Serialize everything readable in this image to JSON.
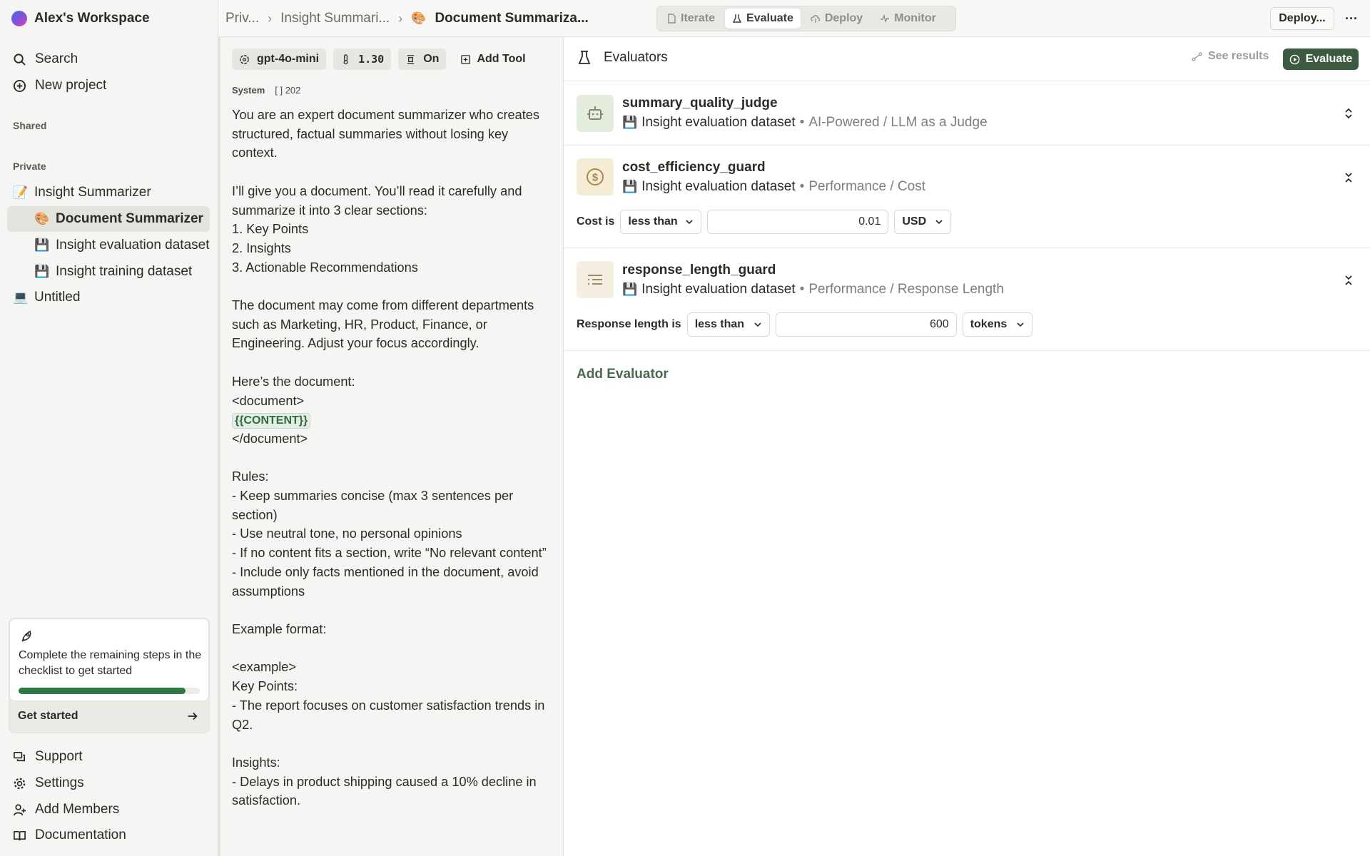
{
  "workspace": {
    "name": "Alex's Workspace"
  },
  "sidebar": {
    "search": "Search",
    "new_project": "New project",
    "shared_label": "Shared",
    "private_label": "Private",
    "tree": [
      {
        "emoji": "📝",
        "label": "Insight Summarizer"
      },
      {
        "emoji": "🎨",
        "label": "Document Summarizer"
      },
      {
        "emoji": "💾",
        "label": "Insight evaluation dataset"
      },
      {
        "emoji": "💾",
        "label": "Insight training dataset"
      },
      {
        "emoji": "💻",
        "label": "Untitled"
      }
    ],
    "checklist": {
      "text": "Complete the remaining steps in the checklist to get started",
      "progress": 0.92,
      "cta": "Get started"
    },
    "bottom": {
      "support": "Support",
      "settings": "Settings",
      "add_members": "Add Members",
      "documentation": "Documentation"
    }
  },
  "topbar": {
    "crumbs": [
      "Priv...",
      "Insight Summari...",
      "Document Summariza..."
    ],
    "current_emoji": "🎨",
    "modes": [
      "Iterate",
      "Evaluate",
      "Deploy",
      "Monitor"
    ],
    "active_mode": "Evaluate",
    "deploy": "Deploy...",
    "more": "···"
  },
  "prompt": {
    "model": "gpt-4o-mini",
    "temperature": "1.30",
    "json_mode": "On",
    "add_tool": "Add Tool",
    "role": "System",
    "token_count": "202",
    "text_before": "You are an expert document summarizer who creates structured, factual summaries without losing key context.\n\nI’ll give you a document. You’ll read it carefully and summarize it into 3 clear sections:\n1. Key Points\n2. Insights\n3. Actionable Recommendations\n\nThe document may come from different departments such as Marketing, HR, Product, Finance, or Engineering. Adjust your focus accordingly.\n\nHere’s the document:\n<document>\n",
    "variable": "{{CONTENT}}",
    "text_after": "\n</document>\n\nRules:\n- Keep summaries concise (max 3 sentences per section)\n- Use neutral tone, no personal opinions\n- If no content fits a section, write “No relevant content”\n- Include only facts mentioned in the document, avoid assumptions\n\nExample format:\n\n<example>\nKey Points:\n- The report focuses on customer satisfaction trends in Q2.\n\nInsights:\n- Delays in product shipping caused a 10% decline in satisfaction."
  },
  "evaluators": {
    "title": "Evaluators",
    "see_results": "See results",
    "evaluate": "Evaluate",
    "add": "Add Evaluator",
    "items": [
      {
        "name": "summary_quality_judge",
        "dataset": "Insight evaluation dataset",
        "category": "AI-Powered / LLM as a Judge"
      },
      {
        "name": "cost_efficiency_guard",
        "dataset": "Insight evaluation dataset",
        "category": "Performance / Cost",
        "cond_label": "Cost is",
        "operator": "less than",
        "value": "0.01",
        "unit": "USD"
      },
      {
        "name": "response_length_guard",
        "dataset": "Insight evaluation dataset",
        "category": "Performance / Response Length",
        "cond_label": "Response length is",
        "operator": "less than",
        "value": "600",
        "unit": "tokens"
      }
    ]
  },
  "colors": {
    "accent": "#3c5a3f",
    "progress": "#2f7a44",
    "judge_icon_bg": "#e4ecdd",
    "cost_icon_bg": "#f6ecd6",
    "length_icon_bg": "#f4efe0"
  }
}
